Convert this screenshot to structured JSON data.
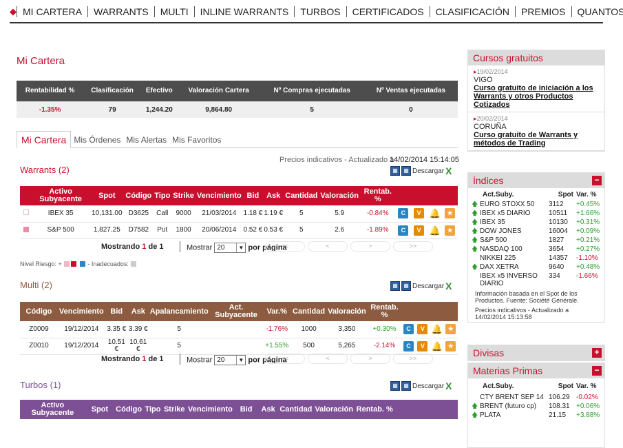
{
  "nav": {
    "items": [
      "MI CARTERA",
      "WARRANTS",
      "MULTI",
      "INLINE WARRANTS",
      "TURBOS",
      "CERTIFICADOS",
      "CLASIFICACIÓN",
      "PREMIOS",
      "QUANTOS"
    ]
  },
  "page_title": "Mi Cartera",
  "summary": {
    "headers": [
      "Rentabilidad %",
      "Clasificación",
      "Efectivo",
      "Valoración Cartera",
      "Nº Compras ejecutadas",
      "Nº Ventas ejecutadas"
    ],
    "values": [
      "-1.35%",
      "79",
      "1,244.20",
      "9,864.80",
      "5",
      "0"
    ]
  },
  "tabs": [
    "Mi Cartera",
    "Mis Órdenes",
    "Mis Alertas",
    "Mis Favoritos"
  ],
  "prices_note": "Precios indicativos - Actualizado a",
  "prices_date": "14/02/2014 15:14:05",
  "download_label": "Descargar",
  "buttons": {
    "c": "C",
    "v": "V",
    "bell": "🔔",
    "star": "★"
  },
  "warrants": {
    "title": "Warrants (2)",
    "headers": [
      "Activo Subyacente",
      "Spot",
      "Código",
      "Tipo",
      "Strike",
      "Vencimiento",
      "Bid",
      "Ask",
      "Cantidad",
      "Valoración",
      "Rentab. %"
    ],
    "rows": [
      [
        "IBEX 35",
        "10,131.00",
        "D3625",
        "Call",
        "9000",
        "21/03/2014",
        "1.18 €",
        "1.19 €",
        "5",
        "5.9",
        "-0.84%"
      ],
      [
        "S&P 500",
        "1,827.25",
        "D7582",
        "Put",
        "1800",
        "20/06/2014",
        "0.52 €",
        "0.53 €",
        "5",
        "2.6",
        "-1.89%"
      ]
    ]
  },
  "pager": {
    "showing_prefix": "Mostrando",
    "showing_page": "1",
    "showing_mid": "de",
    "showing_total": "1",
    "show_label": "Mostrar",
    "page_size": "20",
    "per_page": "por página",
    "first": "<<",
    "prev": "<",
    "next": ">",
    "last": ">>"
  },
  "risk": {
    "label": "Nivel Riesgo: +",
    "mid": "-",
    "inadequate": "Inadecuados:"
  },
  "multi": {
    "title": "Multi (2)",
    "headers": [
      "Código",
      "Vencimiento",
      "Bid",
      "Ask",
      "Apalancamiento",
      "Act. Subyacente",
      "Var.%",
      "Cantidad",
      "Valoración",
      "Rentab. %"
    ],
    "rows": [
      [
        "Z0009",
        "19/12/2014",
        "3.35 €",
        "3.39 €",
        "5",
        "",
        "-1.76%",
        "1000",
        "3,350",
        "+0.30%"
      ],
      [
        "Z0010",
        "19/12/2014",
        "10.51 €",
        "10.61 €",
        "5",
        "",
        "+1.55%",
        "500",
        "5,265",
        "-2.14%"
      ]
    ]
  },
  "turbos": {
    "title": "Turbos (1)",
    "headers": [
      "Activo Subyacente",
      "Spot",
      "Código",
      "Tipo",
      "Strike",
      "Vencimiento",
      "Bid",
      "Ask",
      "Cantidad",
      "Valoración",
      "Rentab. %"
    ]
  },
  "sidebar": {
    "cursos": {
      "title": "Cursos gratuitos",
      "items": [
        {
          "date": "19/02/2014",
          "city": "VIGO",
          "link": "Curso gratuito de iniciación a los Warrants y otros Productos Cotizados"
        },
        {
          "date": "20/02/2014",
          "city": "CORUÑA",
          "link": "Curso gratuito de Warrants y métodos de Trading"
        }
      ]
    },
    "indices": {
      "title": "Índices",
      "toggle": "−",
      "headers": [
        "Act.Suby.",
        "Spot",
        "Var. %"
      ],
      "rows": [
        {
          "up": true,
          "name": "EURO STOXX 50",
          "spot": "3112",
          "var": "+0.45%"
        },
        {
          "up": true,
          "name": "IBEX x5 DIARIO",
          "spot": "10511",
          "var": "+1.66%"
        },
        {
          "up": true,
          "name": "IBEX 35",
          "spot": "10130",
          "var": "+0.31%"
        },
        {
          "up": true,
          "name": "DOW JONES",
          "spot": "16004",
          "var": "+0.09%"
        },
        {
          "up": true,
          "name": "S&P 500",
          "spot": "1827",
          "var": "+0.21%"
        },
        {
          "up": true,
          "name": "NASDAQ 100",
          "spot": "3654",
          "var": "+0.27%"
        },
        {
          "up": false,
          "name": "NIKKEI 225",
          "spot": "14357",
          "var": "-1.10%"
        },
        {
          "up": true,
          "name": "DAX XETRA",
          "spot": "9640",
          "var": "+0.48%"
        },
        {
          "up": false,
          "name": "IBEX x5 INVERSO DIARIO",
          "spot": "334",
          "var": "-1.66%"
        }
      ],
      "note1": "Información basada en el Spot de los Productos. Fuente: Société Générale.",
      "note2": "Precios indicativos - Actualizado a 14/02/2014 15:13:58"
    },
    "divisas": {
      "title": "Divisas",
      "toggle": "+"
    },
    "materias": {
      "title": "Materias Primas",
      "toggle": "−",
      "headers": [
        "Act.Suby.",
        "Spot",
        "Var. %"
      ],
      "rows": [
        {
          "up": false,
          "name": "CTY BRENT SEP 14",
          "spot": "106.29",
          "var": "-0.02%"
        },
        {
          "up": true,
          "name": "BRENT (futuro cp)",
          "spot": "108.31",
          "var": "+0.06%"
        },
        {
          "up": true,
          "name": "PLATA",
          "spot": "21.15",
          "var": "+3.88%"
        }
      ]
    }
  },
  "colors": {
    "accent": "#c8102e",
    "warrants": "#c8102e",
    "multi": "#8d5c40",
    "turbos": "#7d4f94",
    "positive": "#2a9d2a"
  }
}
